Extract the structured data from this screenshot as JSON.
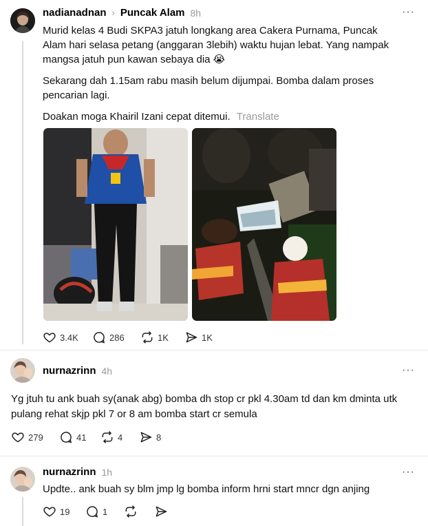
{
  "posts": [
    {
      "username": "nadianadnan",
      "topic": "Puncak Alam",
      "time": "8h",
      "paragraphs": [
        "Murid kelas 4 Budi SKPA3 jatuh longkang area Cakera Purnama, Puncak Alam hari selasa petang (anggaran 3lebih) waktu hujan lebat. Yang nampak mangsa jatuh pun kawan sebaya dia 😭",
        "Sekarang dah 1.15am rabu masih belum dijumpai. Bomba dalam proses pencarian lagi.",
        "Doakan moga Khairil Izani cepat ditemui."
      ],
      "translate": "Translate",
      "likes": "3.4K",
      "comments": "286",
      "reposts": "1K",
      "shares": "1K"
    },
    {
      "username": "nurnazrinn",
      "time": "4h",
      "text": "Yg jtuh tu ank buah sy(anak abg) bomba dh stop cr pkl 4.30am td dan km dminta utk pulang rehat skjp pkl 7 or 8 am bomba start cr semula",
      "likes": "279",
      "comments": "41",
      "reposts": "4",
      "shares": "8"
    },
    {
      "username": "nurnazrinn",
      "time": "1h",
      "text": "Updte.. ank buah sy blm jmp lg bomba inform hrni start mncr dgn anjing",
      "likes": "19",
      "comments": "1"
    }
  ],
  "more_label": "···",
  "colors": {
    "muted": "#999999",
    "divider": "#e6e6e6",
    "accent": "#000000"
  }
}
